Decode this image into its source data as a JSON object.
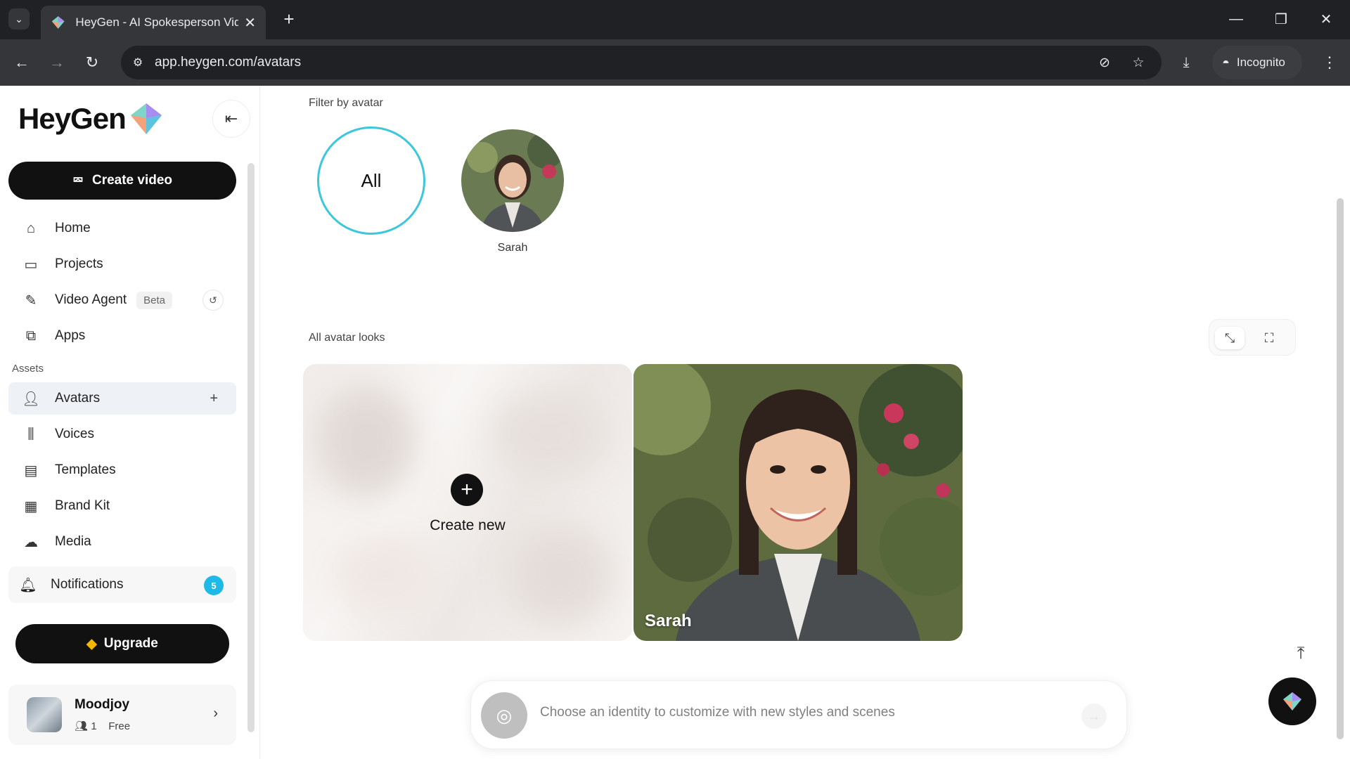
{
  "browser": {
    "tab_title": "HeyGen - AI Spokesperson Video",
    "url": "app.heygen.com/avatars",
    "incognito_label": "Incognito"
  },
  "sidebar": {
    "logo": "HeyGen",
    "create_video": "Create video",
    "nav": [
      {
        "label": "Home",
        "icon": "home-icon"
      },
      {
        "label": "Projects",
        "icon": "video-camera-icon"
      },
      {
        "label": "Video Agent",
        "icon": "wand-icon",
        "badge": "Beta"
      },
      {
        "label": "Apps",
        "icon": "apps-icon"
      }
    ],
    "assets_label": "Assets",
    "assets": [
      {
        "label": "Avatars",
        "icon": "person-icon",
        "active": true
      },
      {
        "label": "Voices",
        "icon": "waveform-icon"
      },
      {
        "label": "Templates",
        "icon": "template-icon"
      },
      {
        "label": "Brand Kit",
        "icon": "brand-kit-icon"
      },
      {
        "label": "Media",
        "icon": "upload-cloud-icon"
      }
    ],
    "notifications": {
      "label": "Notifications",
      "count": "5"
    },
    "upgrade": "Upgrade",
    "profile": {
      "name": "Moodjoy",
      "members": "1",
      "plan": "Free"
    }
  },
  "main": {
    "filter_label": "Filter by avatar",
    "filter_all": "All",
    "filter_avatar_name": "Sarah",
    "looks_label": "All avatar looks",
    "create_new": "Create new",
    "look_card_name": "Sarah",
    "prompt_placeholder": "Choose an identity to customize with new styles and scenes"
  },
  "colors": {
    "accent": "#3ec6dd",
    "badge": "#1eb9e6",
    "primary_button": "#111111",
    "upgrade_gem": "#f5b700"
  }
}
